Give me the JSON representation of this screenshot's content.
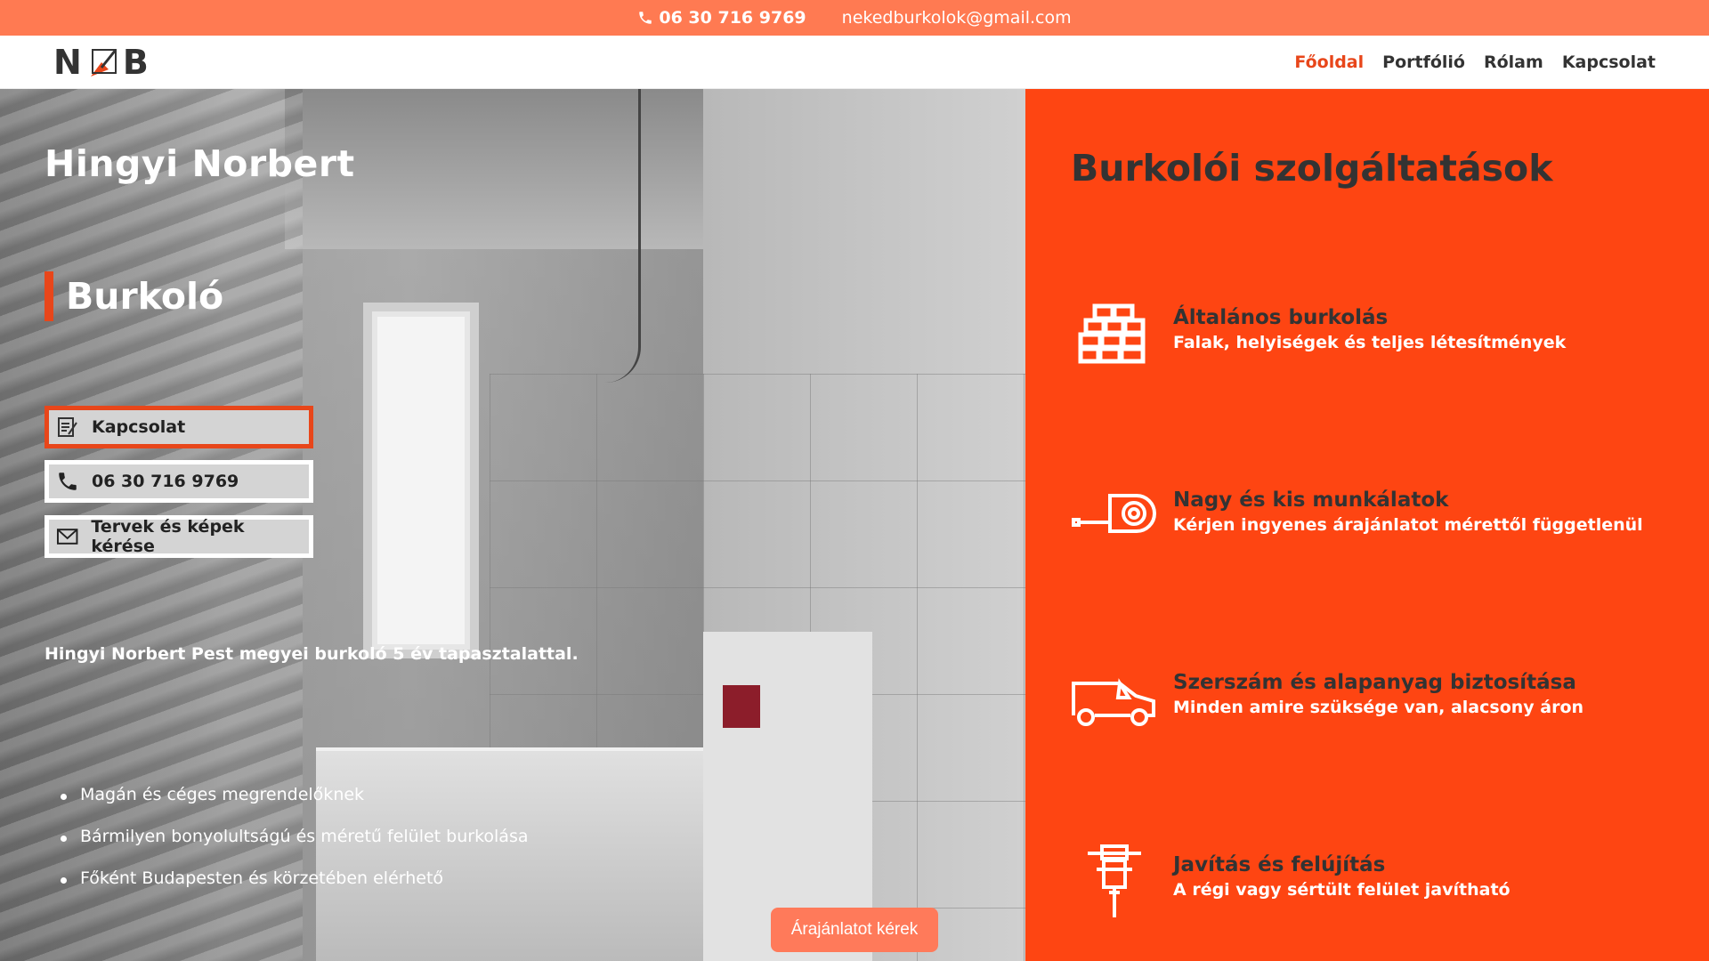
{
  "topbar": {
    "phone": "06 30 716 9769",
    "email": "nekedburkolok@gmail.com"
  },
  "header": {
    "logo_left": "N",
    "logo_right": "B",
    "nav": [
      {
        "label": "Főoldal",
        "active": true
      },
      {
        "label": "Portfólió",
        "active": false
      },
      {
        "label": "Rólam",
        "active": false
      },
      {
        "label": "Kapcsolat",
        "active": false
      }
    ]
  },
  "hero": {
    "name": "Hingyi Norbert",
    "role": "Burkoló",
    "buttons": [
      {
        "label": "Kapcsolat",
        "icon": "edit-note-icon"
      },
      {
        "label": "06 30 716 9769",
        "icon": "phone-icon"
      },
      {
        "label": "Tervek és képek kérése",
        "icon": "envelope-icon"
      }
    ],
    "description": "Hingyi Norbert Pest megyei burkoló 5 év tapasztalattal.",
    "list": [
      "Magán és céges megrendelőknek",
      "Bármilyen bonyolultságú és méretű felület burkolása",
      "Főként Budapesten és körzetében elérhető"
    ],
    "quote_button": "Árajánlatot kérek"
  },
  "services": {
    "title": "Burkolói szolgáltatások",
    "items": [
      {
        "title": "Általános burkolás",
        "desc": "Falak, helyiségek és teljes létesítmények",
        "icon": "bricks-icon"
      },
      {
        "title": "Nagy és kis munkálatok",
        "desc": "Kérjen ingyenes árajánlatot mérettől függetlenül",
        "icon": "tape-measure-icon"
      },
      {
        "title": "Szerszám és alapanyag biztosítása",
        "desc": "Minden amire szüksége van, alacsony áron",
        "icon": "van-icon"
      },
      {
        "title": "Javítás és felújítás",
        "desc": "A régi vagy sértült felület javítható",
        "icon": "jackhammer-icon"
      }
    ]
  },
  "colors": {
    "accent": "#e8461a",
    "topbar": "#ff7a52",
    "panel": "#fe4512",
    "quote_button": "#ff7a5a"
  }
}
